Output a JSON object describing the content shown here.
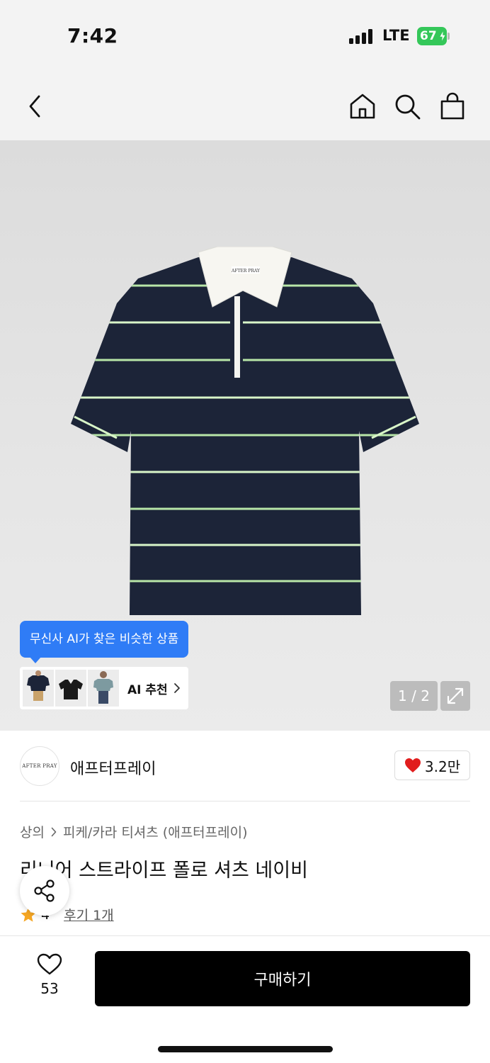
{
  "status_bar": {
    "time": "7:42",
    "network": "LTE",
    "battery": "67",
    "battery_color": "#34c759"
  },
  "header": {
    "back_icon": "chevron-left-icon",
    "home_icon": "home-icon",
    "search_icon": "search-icon",
    "cart_icon": "shopping-bag-icon"
  },
  "hero": {
    "ai_tooltip": "무신사 AI가 찾은 비슷한 상품",
    "ai_recommend_label": "AI 추천",
    "pager": "1 / 2",
    "tooltip_color": "#2f7cf6"
  },
  "brand": {
    "logo_text": "AFTER PRAY",
    "name": "애프터프레이",
    "like_count": "3.2만"
  },
  "product": {
    "breadcrumb": [
      "상의",
      "피케/카라 티셔츠 (애프터프레이)"
    ],
    "title": "리니어 스트라이프 폴로 셔츠 네이비",
    "rating": "4",
    "review_link": "후기 1개"
  },
  "bottom_bar": {
    "wish_count": "53",
    "buy_label": "구매하기"
  }
}
